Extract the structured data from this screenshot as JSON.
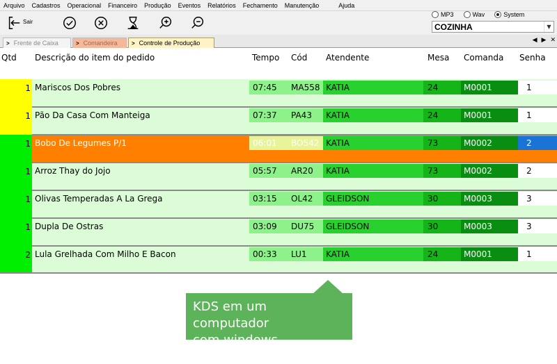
{
  "menu": [
    "Arquivo",
    "Cadastros",
    "Operacional",
    "Financeiro",
    "Produção",
    "Eventos",
    "Relatórios",
    "Fechamento",
    "Manutenção",
    "Ajuda"
  ],
  "toolbar": {
    "exit_label": "Sair",
    "icons": [
      "exit-icon",
      "check-circle-icon",
      "cancel-circle-icon",
      "hourglass-icon",
      "zoom-in-icon",
      "zoom-out-icon"
    ]
  },
  "sound": {
    "options": [
      "MP3",
      "Wav",
      "System"
    ],
    "selected": "System"
  },
  "station": {
    "value": "COZINHA"
  },
  "tabs": [
    {
      "label": "Frente de Caixa"
    },
    {
      "label": "Comandeira"
    },
    {
      "label": "Controle de Produção"
    }
  ],
  "tab_controls": [
    "◀",
    "▶",
    "✕"
  ],
  "table": {
    "headers": {
      "qtd": "Qtd",
      "desc": "Descrição do item do pedido",
      "tempo": "Tempo",
      "cod": "Cód",
      "atendente": "Atendente",
      "mesa": "Mesa",
      "comanda": "Comanda",
      "senha": "Senha"
    },
    "rows": [
      {
        "qtd": "1",
        "desc": "Mariscos Dos Pobres",
        "tempo": "07:45",
        "cod": "MA558",
        "atendente": "KATIA",
        "mesa": "24",
        "comanda": "M0001",
        "senha": "1",
        "bar_color": "#ffff00",
        "selected": false
      },
      {
        "qtd": "1",
        "desc": "Pão Da Casa Com Manteiga",
        "tempo": "07:37",
        "cod": "PA43",
        "atendente": "KATIA",
        "mesa": "24",
        "comanda": "M0001",
        "senha": "1",
        "bar_color": "#ffff00",
        "selected": false
      },
      {
        "qtd": "1",
        "desc": "Bobo De Legumes P/1",
        "tempo": "06:01",
        "cod": "BO542",
        "atendente": "KATIA",
        "mesa": "73",
        "comanda": "M0002",
        "senha": "2",
        "bar_color": "#00ee00",
        "selected": true
      },
      {
        "qtd": "1",
        "desc": "Arroz Thay do Jojo",
        "tempo": "05:57",
        "cod": "AR20",
        "atendente": "KATIA",
        "mesa": "73",
        "comanda": "M0002",
        "senha": "2",
        "bar_color": "#00ee00",
        "selected": false
      },
      {
        "qtd": "1",
        "desc": "Olivas Temperadas A La Grega",
        "tempo": "03:15",
        "cod": "OL42",
        "atendente": "GLEIDSON",
        "mesa": "30",
        "comanda": "M0003",
        "senha": "3",
        "bar_color": "#00ee00",
        "selected": false
      },
      {
        "qtd": "1",
        "desc": "Dupla De Ostras",
        "tempo": "03:09",
        "cod": "DU75",
        "atendente": "GLEIDSON",
        "mesa": "30",
        "comanda": "M0003",
        "senha": "3",
        "bar_color": "#00ee00",
        "selected": false
      },
      {
        "qtd": "2",
        "desc": "Lula Grelhada Com Milho E Bacon",
        "tempo": "00:33",
        "cod": "LU1",
        "atendente": "KATIA",
        "mesa": "24",
        "comanda": "M0001",
        "senha": "1",
        "bar_color": "#00ee00",
        "selected": false
      }
    ]
  },
  "callout": {
    "line1": "KDS em um computador",
    "line2": "com windows."
  },
  "colors": {
    "row_bg": "#dcfcd8",
    "selected_row": "#ff8000",
    "senha_selected": "#1a74d6",
    "callout": "#5cb35a"
  }
}
